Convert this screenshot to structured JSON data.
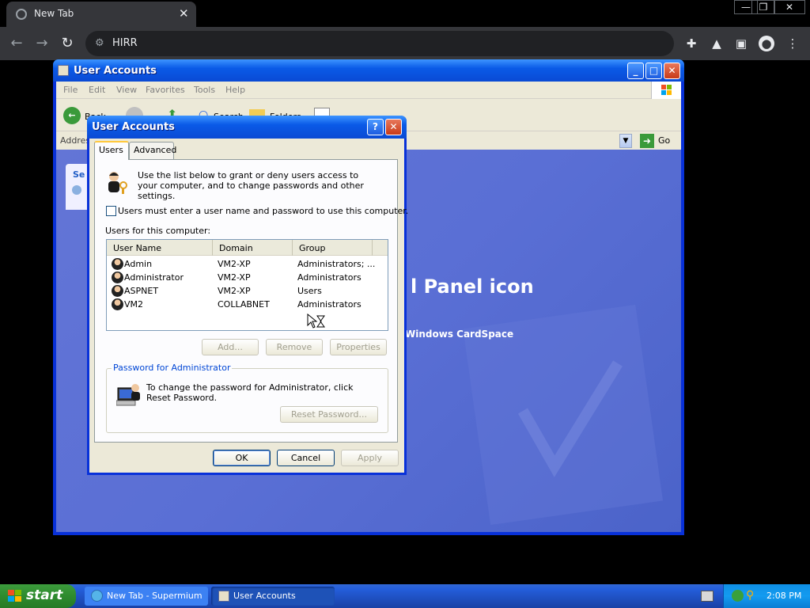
{
  "browser": {
    "tab_title": "New Tab",
    "address": "HIRR",
    "icons": [
      "globe-icon",
      "close-icon",
      "back-icon",
      "forward-icon",
      "reload-icon",
      "info-icon",
      "extensions-icon",
      "lab-icon",
      "sidepanel-icon",
      "profile-icon",
      "menu-icon"
    ]
  },
  "explorer": {
    "title": "User Accounts",
    "menu": [
      "File",
      "Edit",
      "View",
      "Favorites",
      "Tools",
      "Help"
    ],
    "toolbar": {
      "back": "Back",
      "search": "Search",
      "folders": "Folders"
    },
    "address_label": "Address",
    "go_label": "Go",
    "sidebar_heading": "Se",
    "content_heading": "l Panel icon",
    "content_link": "Windows CardSpace"
  },
  "dialog": {
    "title": "User Accounts",
    "tabs": [
      "Users",
      "Advanced"
    ],
    "intro": "Use the list below to grant or deny users access to your computer, and to change passwords and other settings.",
    "checkbox_label": "Users must enter a user name and password to use this computer.",
    "checkbox_checked": false,
    "list_label": "Users for this computer:",
    "columns": [
      "User Name",
      "Domain",
      "Group"
    ],
    "rows": [
      {
        "name": "Admin",
        "domain": "VM2-XP",
        "group": "Administrators; ..."
      },
      {
        "name": "Administrator",
        "domain": "VM2-XP",
        "group": "Administrators"
      },
      {
        "name": "ASPNET",
        "domain": "VM2-XP",
        "group": "Users"
      },
      {
        "name": "VM2",
        "domain": "COLLABNET",
        "group": "Administrators"
      }
    ],
    "buttons": {
      "add": "Add...",
      "remove": "Remove",
      "properties": "Properties"
    },
    "password_group_title": "Password for Administrator",
    "password_text": "To change the password for Administrator, click Reset Password.",
    "reset_password": "Reset Password...",
    "ok": "OK",
    "cancel": "Cancel",
    "apply": "Apply"
  },
  "taskbar": {
    "start": "start",
    "tasks": [
      {
        "label": "New Tab - Supermium"
      },
      {
        "label": "User Accounts"
      }
    ],
    "clock": "2:08 PM"
  }
}
